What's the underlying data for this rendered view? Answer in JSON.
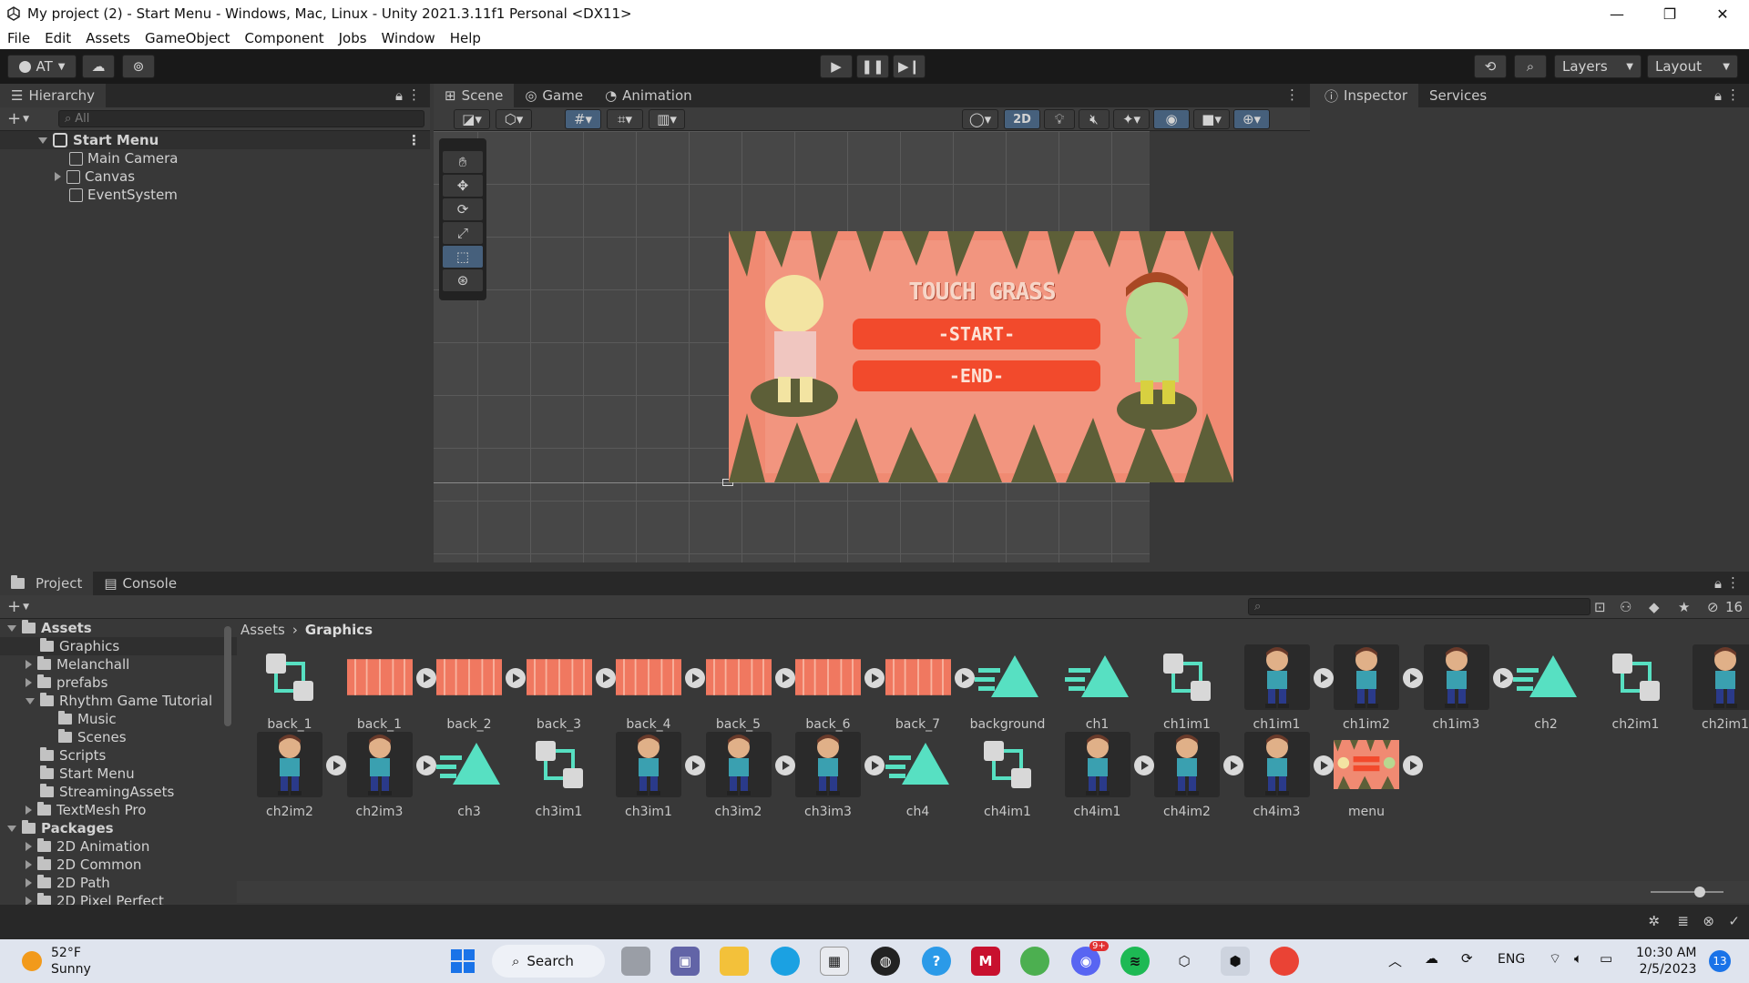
{
  "window": {
    "title": "My project (2) - Start Menu - Windows, Mac, Linux - Unity 2021.3.11f1 Personal <DX11>",
    "minimize": "—",
    "restore": "❐",
    "close": "✕"
  },
  "menu": [
    "File",
    "Edit",
    "Assets",
    "GameObject",
    "Component",
    "Jobs",
    "Window",
    "Help"
  ],
  "toolbar": {
    "account": "AT",
    "layers": "Layers",
    "layout": "Layout"
  },
  "hierarchy": {
    "tab": "Hierarchy",
    "search_placeholder": "All",
    "scene": "Start Menu",
    "items": [
      "Main Camera",
      "Canvas",
      "EventSystem"
    ]
  },
  "scene_tabs": [
    "Scene",
    "Game",
    "Animation"
  ],
  "scene_toolbar": {
    "mode_2d": "2D"
  },
  "game_view": {
    "title": "TOUCH GRASS",
    "start": "-START-",
    "end": "-END-",
    "colors": {
      "bg": "#f08a72",
      "button": "#f24a2c",
      "grass": "#5d5f38"
    }
  },
  "inspector_tabs": [
    "Inspector",
    "Services"
  ],
  "project": {
    "tabs": [
      "Project",
      "Console"
    ],
    "hidden_count": "16",
    "tree": [
      {
        "label": "Assets",
        "level": 0,
        "bold": true
      },
      {
        "label": "Graphics",
        "level": 1
      },
      {
        "label": "Melanchall",
        "level": 1
      },
      {
        "label": "prefabs",
        "level": 1
      },
      {
        "label": "Rhythm Game Tutorial",
        "level": 1
      },
      {
        "label": "Music",
        "level": 2
      },
      {
        "label": "Scenes",
        "level": 2
      },
      {
        "label": "Scripts",
        "level": 1
      },
      {
        "label": "Start Menu",
        "level": 1
      },
      {
        "label": "StreamingAssets",
        "level": 1
      },
      {
        "label": "TextMesh Pro",
        "level": 1
      },
      {
        "label": "Packages",
        "level": 0,
        "bold": true
      },
      {
        "label": "2D Animation",
        "level": 1
      },
      {
        "label": "2D Common",
        "level": 1
      },
      {
        "label": "2D Path",
        "level": 1
      },
      {
        "label": "2D Pixel Perfect",
        "level": 1
      }
    ],
    "breadcrumb": [
      "Assets",
      "Graphics"
    ],
    "assets_row1": [
      {
        "name": "back_1",
        "kind": "controller"
      },
      {
        "name": "back_1",
        "kind": "sprite"
      },
      {
        "name": "back_2",
        "kind": "sprite"
      },
      {
        "name": "back_3",
        "kind": "sprite"
      },
      {
        "name": "back_4",
        "kind": "sprite"
      },
      {
        "name": "back_5",
        "kind": "sprite"
      },
      {
        "name": "back_6",
        "kind": "sprite"
      },
      {
        "name": "back_7",
        "kind": "sprite"
      },
      {
        "name": "background",
        "kind": "anim"
      },
      {
        "name": "ch1",
        "kind": "anim"
      },
      {
        "name": "ch1im1",
        "kind": "controller"
      },
      {
        "name": "ch1im1",
        "kind": "char"
      },
      {
        "name": "ch1im2",
        "kind": "char"
      },
      {
        "name": "ch1im3",
        "kind": "char"
      },
      {
        "name": "ch2",
        "kind": "anim"
      },
      {
        "name": "ch2im1",
        "kind": "controller"
      },
      {
        "name": "ch2im1",
        "kind": "char"
      }
    ],
    "assets_row2": [
      {
        "name": "ch2im2",
        "kind": "char"
      },
      {
        "name": "ch2im3",
        "kind": "char"
      },
      {
        "name": "ch3",
        "kind": "anim"
      },
      {
        "name": "ch3im1",
        "kind": "controller"
      },
      {
        "name": "ch3im1",
        "kind": "char"
      },
      {
        "name": "ch3im2",
        "kind": "char"
      },
      {
        "name": "ch3im3",
        "kind": "char"
      },
      {
        "name": "ch4",
        "kind": "anim"
      },
      {
        "name": "ch4im1",
        "kind": "controller"
      },
      {
        "name": "ch4im1",
        "kind": "char"
      },
      {
        "name": "ch4im2",
        "kind": "char"
      },
      {
        "name": "ch4im3",
        "kind": "char"
      },
      {
        "name": "menu",
        "kind": "menu"
      }
    ]
  },
  "taskbar": {
    "weather_temp": "52°F",
    "weather_desc": "Sunny",
    "search": "Search",
    "lang": "ENG",
    "time": "10:30 AM",
    "date": "2/5/2023",
    "notif_count": "13",
    "discord_badge": "9+"
  }
}
